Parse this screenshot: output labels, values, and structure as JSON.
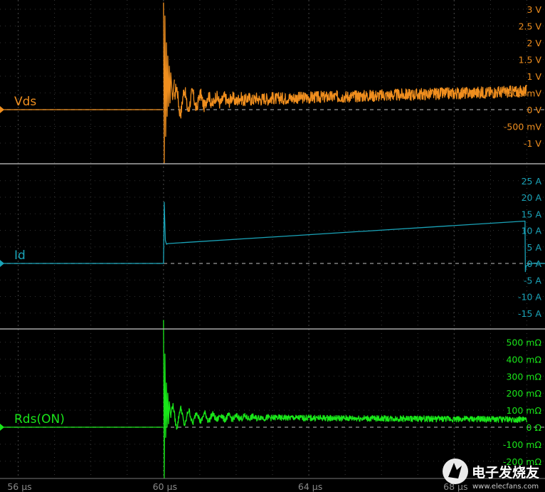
{
  "chart_data": {
    "type": "line",
    "x_unit": "µs",
    "xlim": [
      55.5,
      70.5
    ],
    "x_ticks": [
      {
        "value": 56,
        "label": "56 µs"
      },
      {
        "value": 60,
        "label": "60 µs"
      },
      {
        "value": 64,
        "label": "64 µs"
      },
      {
        "value": 68,
        "label": "68 µs"
      }
    ],
    "grid": true,
    "panels": [
      {
        "name": "Vds",
        "color": "#ef8e1e",
        "ylim": [
          -1.3,
          3.2
        ],
        "y_ticks": [
          {
            "value": 3,
            "label": "3 V"
          },
          {
            "value": 2.5,
            "label": "2.5 V"
          },
          {
            "value": 2,
            "label": "2 V"
          },
          {
            "value": 1.5,
            "label": "1.5 V"
          },
          {
            "value": 1,
            "label": "1 V"
          },
          {
            "value": 0.5,
            "label": "500 mV"
          },
          {
            "value": 0,
            "label": "0 V"
          },
          {
            "value": -0.5,
            "label": "-500 mV"
          },
          {
            "value": -1,
            "label": "-1 V"
          }
        ],
        "series": [
          {
            "x": [
              55.5,
              59.99
            ],
            "y": [
              0,
              0
            ]
          },
          {
            "x": [
              60.0,
              60.02,
              60.04,
              60.06,
              60.08,
              60.1,
              60.12,
              60.14,
              60.16,
              60.18,
              60.2,
              60.25,
              60.3
            ],
            "y": [
              3.2,
              -1.6,
              2.8,
              -0.8,
              2.0,
              -0.2,
              1.6,
              0.1,
              1.3,
              0.2,
              1.1,
              0.3,
              0.9
            ]
          },
          {
            "x_range": [
              60.3,
              70.0
            ],
            "baseline": 0.25,
            "baseline_end": 0.55,
            "ring_amp": 0.45,
            "ring_period": 0.22,
            "ring_decay": 1.2,
            "noise": 0.18
          }
        ]
      },
      {
        "name": "Id",
        "color": "#1aa3b8",
        "ylim": [
          -17.5,
          28
        ],
        "y_ticks": [
          {
            "value": 25,
            "label": "25 A"
          },
          {
            "value": 20,
            "label": "20 A"
          },
          {
            "value": 15,
            "label": "15 A"
          },
          {
            "value": 10,
            "label": "10 A"
          },
          {
            "value": 5,
            "label": "5 A"
          },
          {
            "value": 0,
            "label": "0 A"
          },
          {
            "value": -5,
            "label": "-5 A"
          },
          {
            "value": -10,
            "label": "-10 A"
          },
          {
            "value": -15,
            "label": "-15 A"
          }
        ],
        "series": [
          {
            "x": [
              55.5,
              60.0,
              60.02,
              60.05,
              60.08,
              60.12,
              69.95,
              69.96,
              69.98,
              70.05,
              70.2,
              70.5
            ],
            "y": [
              0,
              0,
              18.5,
              7.0,
              5.8,
              6.0,
              12.8,
              -2.5,
              -0.8,
              -0.3,
              0.1,
              0
            ]
          }
        ]
      },
      {
        "name": "Rds(ON)",
        "color": "#19e619",
        "ylim": [
          -300,
          630
        ],
        "y_ticks": [
          {
            "value": 500,
            "label": "500 mΩ"
          },
          {
            "value": 400,
            "label": "400 mΩ"
          },
          {
            "value": 300,
            "label": "300 mΩ"
          },
          {
            "value": 200,
            "label": "200 mΩ"
          },
          {
            "value": 100,
            "label": "100 mΩ"
          },
          {
            "value": 0,
            "label": "0 Ω"
          },
          {
            "value": -100,
            "label": "-100 mΩ"
          },
          {
            "value": -200,
            "label": "-200 mΩ"
          }
        ],
        "series": [
          {
            "x": [
              55.5,
              59.99
            ],
            "y": [
              0,
              0
            ]
          },
          {
            "x": [
              60.0,
              60.02,
              60.04,
              60.06,
              60.08,
              60.1,
              60.12,
              60.14,
              60.16,
              60.2
            ],
            "y": [
              630,
              -300,
              430,
              -60,
              260,
              0,
              200,
              20,
              150,
              60
            ]
          },
          {
            "x_range": [
              60.2,
              70.0
            ],
            "baseline": 60,
            "baseline_end": 45,
            "ring_amp": 70,
            "ring_period": 0.22,
            "ring_decay": 1.2,
            "noise": 18
          }
        ]
      }
    ]
  },
  "watermark": {
    "text": "电子发烧友",
    "url_text": "www.elecfans.com"
  }
}
